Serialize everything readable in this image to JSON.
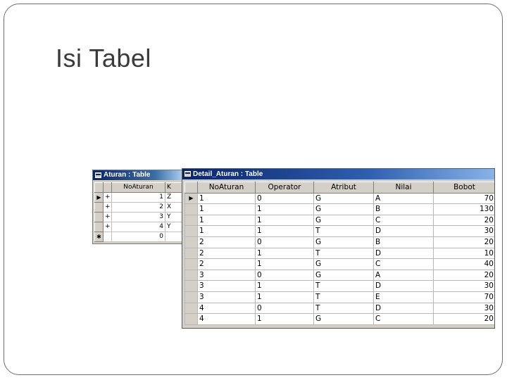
{
  "slide": {
    "title": "Isi Tabel"
  },
  "aturan_window": {
    "title": "Aturan : Table",
    "columns": [
      "NoAturan",
      "K"
    ],
    "rows": [
      {
        "selector": "▶",
        "expand": "+",
        "no": "1",
        "k": "Z"
      },
      {
        "selector": "",
        "expand": "+",
        "no": "2",
        "k": "X"
      },
      {
        "selector": "",
        "expand": "+",
        "no": "3",
        "k": "Y"
      },
      {
        "selector": "",
        "expand": "+",
        "no": "4",
        "k": "Y"
      },
      {
        "selector": "✱",
        "expand": "",
        "no": "0",
        "k": ""
      }
    ]
  },
  "detail_window": {
    "title": "Detail_Aturan : Table",
    "columns": [
      "NoAturan",
      "Operator",
      "Atribut",
      "Nilai",
      "Bobot"
    ],
    "rows": [
      {
        "selector": "▶",
        "noaturan": "1",
        "operator": "0",
        "atribut": "G",
        "nilai": "A",
        "bobot": "70"
      },
      {
        "selector": "",
        "noaturan": "1",
        "operator": "1",
        "atribut": "G",
        "nilai": "B",
        "bobot": "130"
      },
      {
        "selector": "",
        "noaturan": "1",
        "operator": "1",
        "atribut": "G",
        "nilai": "C",
        "bobot": "20"
      },
      {
        "selector": "",
        "noaturan": "1",
        "operator": "1",
        "atribut": "T",
        "nilai": "D",
        "bobot": "30"
      },
      {
        "selector": "",
        "noaturan": "2",
        "operator": "0",
        "atribut": "G",
        "nilai": "B",
        "bobot": "20"
      },
      {
        "selector": "",
        "noaturan": "2",
        "operator": "1",
        "atribut": "T",
        "nilai": "D",
        "bobot": "10"
      },
      {
        "selector": "",
        "noaturan": "2",
        "operator": "1",
        "atribut": "G",
        "nilai": "C",
        "bobot": "40"
      },
      {
        "selector": "",
        "noaturan": "3",
        "operator": "0",
        "atribut": "G",
        "nilai": "A",
        "bobot": "20"
      },
      {
        "selector": "",
        "noaturan": "3",
        "operator": "1",
        "atribut": "T",
        "nilai": "D",
        "bobot": "30"
      },
      {
        "selector": "",
        "noaturan": "3",
        "operator": "1",
        "atribut": "T",
        "nilai": "E",
        "bobot": "70"
      },
      {
        "selector": "",
        "noaturan": "4",
        "operator": "0",
        "atribut": "T",
        "nilai": "D",
        "bobot": "30"
      },
      {
        "selector": "",
        "noaturan": "4",
        "operator": "1",
        "atribut": "G",
        "nilai": "C",
        "bobot": "20"
      }
    ]
  }
}
